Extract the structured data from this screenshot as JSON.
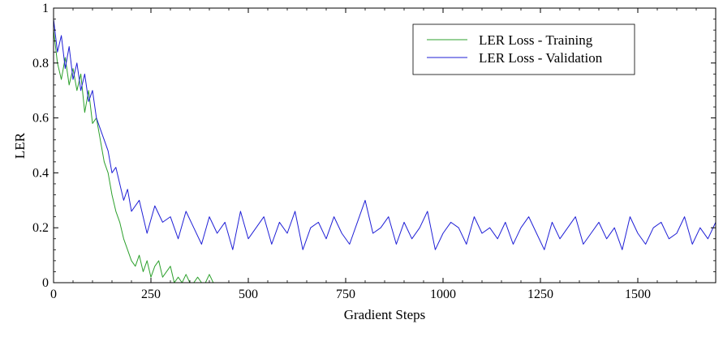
{
  "chart_data": {
    "type": "line",
    "title": "",
    "xlabel": "Gradient Steps",
    "ylabel": "LER",
    "xlim": [
      0,
      1700
    ],
    "ylim": [
      0,
      1
    ],
    "x_ticks": [
      0,
      250,
      500,
      750,
      1000,
      1250,
      1500
    ],
    "x_tick_labels": [
      "0",
      "250",
      "500",
      "750",
      "1000",
      "1250",
      "1500"
    ],
    "y_ticks": [
      0,
      0.2,
      0.4,
      0.6,
      0.8,
      1
    ],
    "y_tick_labels": [
      "0",
      "0.2",
      "0.4",
      "0.6",
      "0.8",
      "1"
    ],
    "grid": false,
    "legend_position": "top-right",
    "series": [
      {
        "name": "LER Loss - Training",
        "color": "#2ca02c",
        "x": [
          0,
          10,
          20,
          30,
          40,
          50,
          60,
          70,
          80,
          90,
          100,
          110,
          120,
          130,
          140,
          150,
          160,
          170,
          180,
          190,
          200,
          210,
          220,
          230,
          240,
          250,
          260,
          270,
          280,
          290,
          300,
          310,
          320,
          330,
          340,
          350,
          360,
          370,
          380,
          390,
          400,
          410
        ],
        "y": [
          0.92,
          0.8,
          0.74,
          0.82,
          0.72,
          0.78,
          0.7,
          0.76,
          0.62,
          0.7,
          0.58,
          0.6,
          0.52,
          0.44,
          0.4,
          0.32,
          0.26,
          0.22,
          0.16,
          0.12,
          0.08,
          0.06,
          0.1,
          0.04,
          0.08,
          0.02,
          0.06,
          0.08,
          0.02,
          0.04,
          0.06,
          0.0,
          0.02,
          0.0,
          0.03,
          0.0,
          0.0,
          0.02,
          0.0,
          0.0,
          0.03,
          0.0
        ]
      },
      {
        "name": "LER Loss - Validation",
        "color": "#1f1fd6",
        "x": [
          0,
          10,
          20,
          30,
          40,
          50,
          60,
          70,
          80,
          90,
          100,
          110,
          120,
          130,
          140,
          150,
          160,
          170,
          180,
          190,
          200,
          220,
          240,
          260,
          280,
          300,
          320,
          340,
          360,
          380,
          400,
          420,
          440,
          460,
          480,
          500,
          520,
          540,
          560,
          580,
          600,
          620,
          640,
          660,
          680,
          700,
          720,
          740,
          760,
          780,
          800,
          820,
          840,
          860,
          880,
          900,
          920,
          940,
          960,
          980,
          1000,
          1020,
          1040,
          1060,
          1080,
          1100,
          1120,
          1140,
          1160,
          1180,
          1200,
          1220,
          1240,
          1260,
          1280,
          1300,
          1320,
          1340,
          1360,
          1380,
          1400,
          1420,
          1440,
          1460,
          1480,
          1500,
          1520,
          1540,
          1560,
          1580,
          1600,
          1620,
          1640,
          1660,
          1680,
          1700
        ],
        "y": [
          0.96,
          0.84,
          0.9,
          0.78,
          0.86,
          0.74,
          0.8,
          0.7,
          0.76,
          0.66,
          0.7,
          0.6,
          0.56,
          0.52,
          0.48,
          0.4,
          0.42,
          0.36,
          0.3,
          0.34,
          0.26,
          0.3,
          0.18,
          0.28,
          0.22,
          0.24,
          0.16,
          0.26,
          0.2,
          0.14,
          0.24,
          0.18,
          0.22,
          0.12,
          0.26,
          0.16,
          0.2,
          0.24,
          0.14,
          0.22,
          0.18,
          0.26,
          0.12,
          0.2,
          0.22,
          0.16,
          0.24,
          0.18,
          0.14,
          0.22,
          0.3,
          0.18,
          0.2,
          0.24,
          0.14,
          0.22,
          0.16,
          0.2,
          0.26,
          0.12,
          0.18,
          0.22,
          0.2,
          0.14,
          0.24,
          0.18,
          0.2,
          0.16,
          0.22,
          0.14,
          0.2,
          0.24,
          0.18,
          0.12,
          0.22,
          0.16,
          0.2,
          0.24,
          0.14,
          0.18,
          0.22,
          0.16,
          0.2,
          0.12,
          0.24,
          0.18,
          0.14,
          0.2,
          0.22,
          0.16,
          0.18,
          0.24,
          0.14,
          0.2,
          0.16,
          0.22
        ]
      }
    ]
  }
}
